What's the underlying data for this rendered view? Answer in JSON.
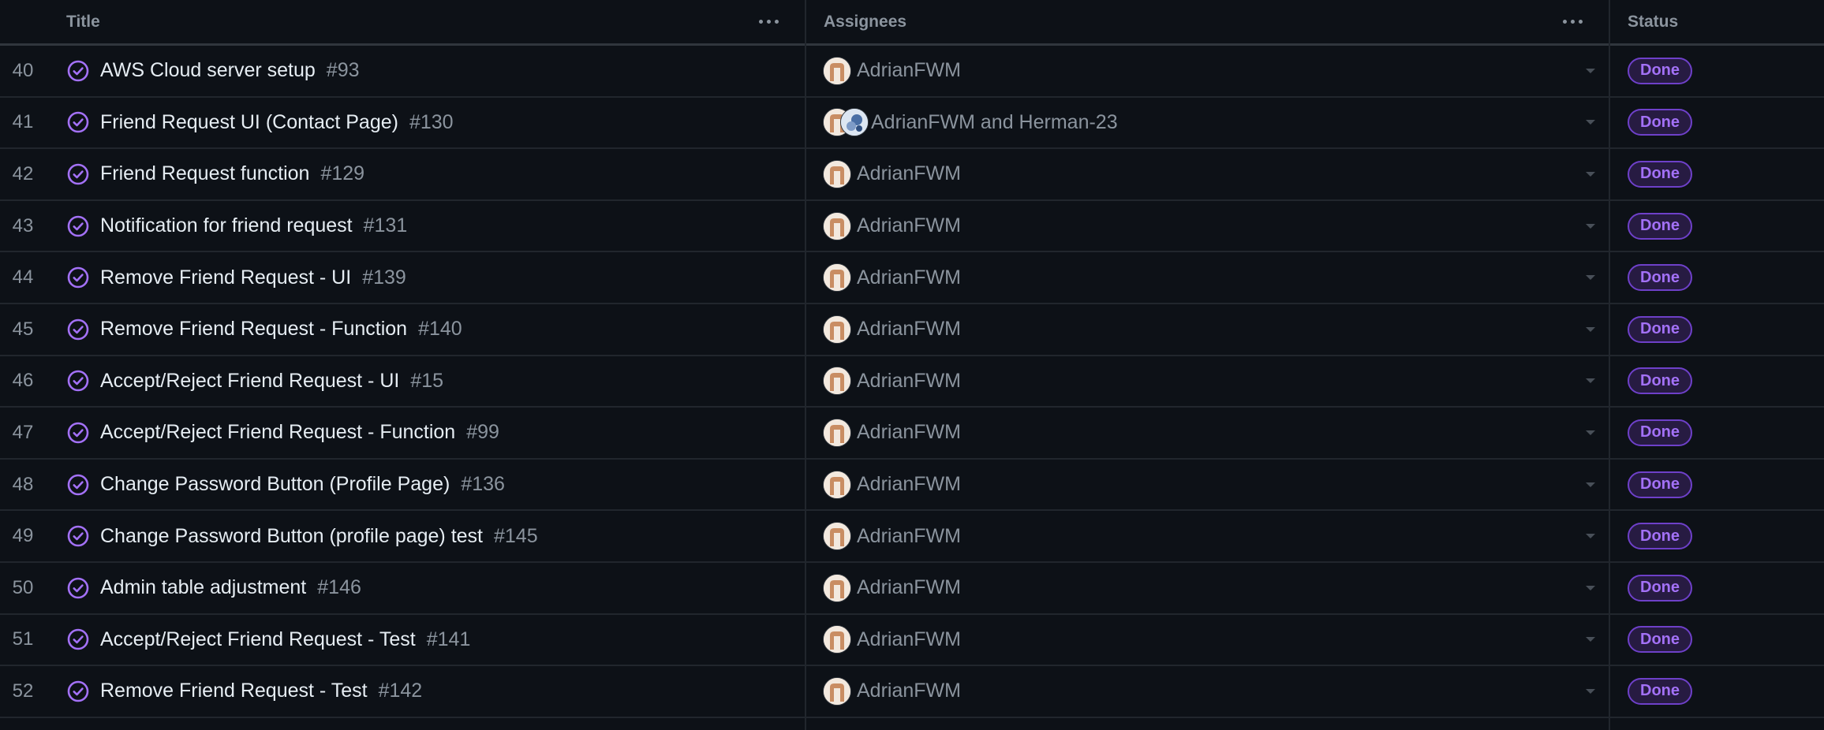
{
  "header": {
    "title_label": "Title",
    "assignees_label": "Assignees",
    "status_label": "Status"
  },
  "colors": {
    "background": "#0d1117",
    "done_purple": "#a371f7",
    "muted_text": "#8b949e"
  },
  "rows": [
    {
      "num": "40",
      "title": "AWS Cloud server setup",
      "issue": "#93",
      "assignees": "AdrianFWM",
      "two_avatars": false,
      "status": "Done"
    },
    {
      "num": "41",
      "title": "Friend Request UI (Contact Page)",
      "issue": "#130",
      "assignees": "AdrianFWM and Herman-23",
      "two_avatars": true,
      "status": "Done"
    },
    {
      "num": "42",
      "title": "Friend Request function",
      "issue": "#129",
      "assignees": "AdrianFWM",
      "two_avatars": false,
      "status": "Done"
    },
    {
      "num": "43",
      "title": "Notification for friend request",
      "issue": "#131",
      "assignees": "AdrianFWM",
      "two_avatars": false,
      "status": "Done"
    },
    {
      "num": "44",
      "title": "Remove Friend Request - UI",
      "issue": "#139",
      "assignees": "AdrianFWM",
      "two_avatars": false,
      "status": "Done"
    },
    {
      "num": "45",
      "title": "Remove Friend Request - Function",
      "issue": "#140",
      "assignees": "AdrianFWM",
      "two_avatars": false,
      "status": "Done"
    },
    {
      "num": "46",
      "title": "Accept/Reject Friend Request - UI",
      "issue": "#15",
      "assignees": "AdrianFWM",
      "two_avatars": false,
      "status": "Done"
    },
    {
      "num": "47",
      "title": "Accept/Reject Friend Request - Function",
      "issue": "#99",
      "assignees": "AdrianFWM",
      "two_avatars": false,
      "status": "Done"
    },
    {
      "num": "48",
      "title": "Change Password Button (Profile Page)",
      "issue": "#136",
      "assignees": "AdrianFWM",
      "two_avatars": false,
      "status": "Done"
    },
    {
      "num": "49",
      "title": "Change Password Button (profile page) test",
      "issue": "#145",
      "assignees": "AdrianFWM",
      "two_avatars": false,
      "status": "Done"
    },
    {
      "num": "50",
      "title": "Admin table adjustment",
      "issue": "#146",
      "assignees": "AdrianFWM",
      "two_avatars": false,
      "status": "Done"
    },
    {
      "num": "51",
      "title": "Accept/Reject Friend Request - Test",
      "issue": "#141",
      "assignees": "AdrianFWM",
      "two_avatars": false,
      "status": "Done"
    },
    {
      "num": "52",
      "title": "Remove Friend Request - Test",
      "issue": "#142",
      "assignees": "AdrianFWM",
      "two_avatars": false,
      "status": "Done"
    }
  ]
}
